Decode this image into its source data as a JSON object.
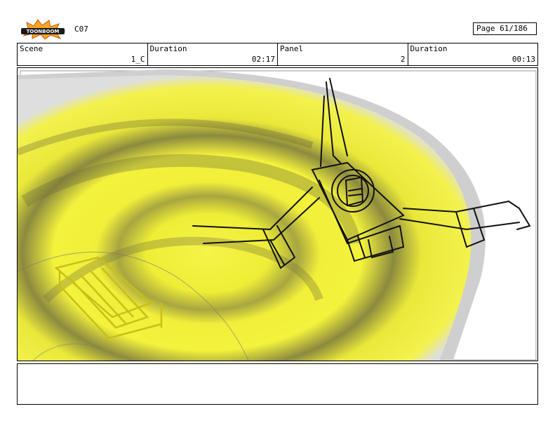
{
  "header": {
    "logo_text": "TOONBOOM",
    "sequence_code": "C07",
    "page_label": "Page",
    "page_value": "61/186"
  },
  "fields": [
    {
      "label": "Scene",
      "value": "1_C"
    },
    {
      "label": "Duration",
      "value": "02:17"
    },
    {
      "label": "Panel",
      "value": "2"
    },
    {
      "label": "Duration",
      "value": "00:13"
    }
  ],
  "notes": {
    "text": ""
  },
  "colors": {
    "sketch_yellow": "#f4f23a",
    "line": "#111111",
    "border": "#000000"
  }
}
